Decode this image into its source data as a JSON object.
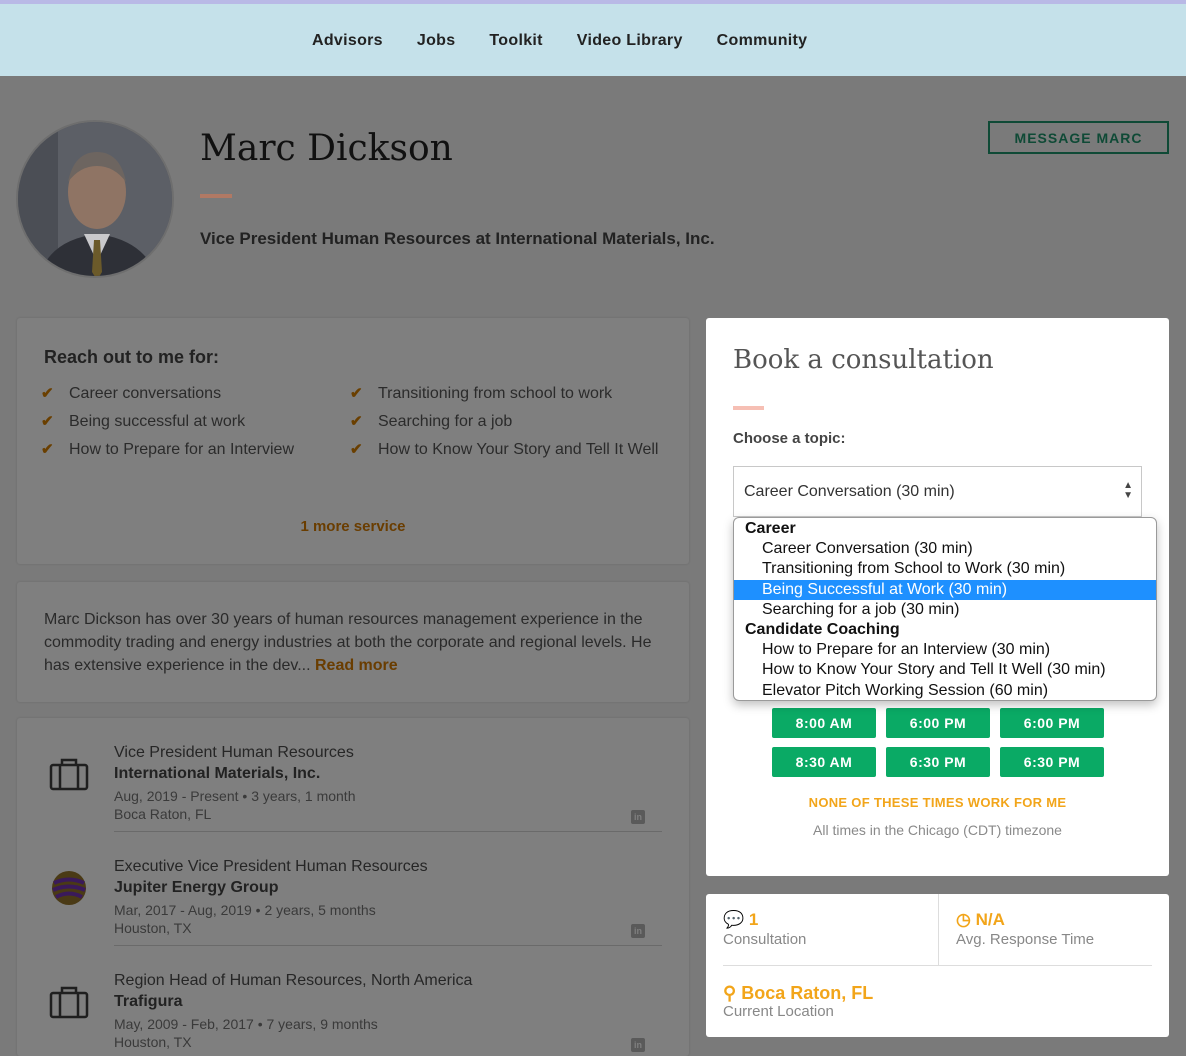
{
  "nav": {
    "items": [
      "Advisors",
      "Jobs",
      "Toolkit",
      "Video Library",
      "Community"
    ]
  },
  "profile": {
    "name": "Marc Dickson",
    "headline": "Vice President Human Resources at International Materials, Inc.",
    "message_button": "MESSAGE MARC"
  },
  "reach": {
    "heading": "Reach out to me for:",
    "services": [
      "Career conversations",
      "Transitioning from school to work",
      "Being successful at work",
      "Searching for a job",
      "How to Prepare for an Interview",
      "How to Know Your Story and Tell It Well"
    ],
    "more": "1 more service"
  },
  "bio": {
    "text": "Marc Dickson has over 30 years of human resources management experience in the commodity trading and energy industries at both the corporate and regional levels. He has extensive experience in the dev... ",
    "read_more": "Read more"
  },
  "experience": [
    {
      "title": "Vice President Human Resources",
      "company": "International Materials, Inc.",
      "dates": "Aug, 2019 - Present • 3 years, 1 month",
      "location": "Boca Raton, FL",
      "logo": "briefcase-icon"
    },
    {
      "title": "Executive Vice President Human Resources",
      "company": "Jupiter Energy Group",
      "dates": "Mar, 2017 - Aug, 2019 • 2 years, 5 months",
      "location": "Houston, TX",
      "logo": "jupiter-logo"
    },
    {
      "title": "Region Head of Human Resources, North America",
      "company": "Trafigura",
      "dates": "May, 2009 - Feb, 2017 • 7 years, 9 months",
      "location": "Houston, TX",
      "logo": "briefcase-icon"
    }
  ],
  "booking": {
    "title": "Book a consultation",
    "topic_label": "Choose a topic:",
    "selected_topic": "Career Conversation (30 min)",
    "dropdown": {
      "groups": [
        {
          "label": "Career",
          "options": [
            "Career Conversation (30 min)",
            "Transitioning from School to Work (30 min)",
            "Being Successful at Work (30 min)",
            "Searching for a job (30 min)"
          ]
        },
        {
          "label": "Candidate Coaching",
          "options": [
            "How to Prepare for an Interview (30 min)",
            "How to Know Your Story and Tell It Well (30 min)",
            "Elevator Pitch Working Session (60 min)"
          ]
        }
      ],
      "highlighted": "Being Successful at Work (30 min)"
    },
    "times": [
      "8:00 AM",
      "6:00 PM",
      "6:00 PM",
      "8:30 AM",
      "6:30 PM",
      "6:30 PM"
    ],
    "none_work": "NONE OF THESE TIMES WORK FOR ME",
    "timezone": "All times in the Chicago (CDT) timezone"
  },
  "stats": {
    "consultations": {
      "value": "1",
      "label": "Consultation"
    },
    "response": {
      "value": "N/A",
      "label": "Avg. Response Time"
    },
    "location": {
      "value": "Boca Raton, FL",
      "label": "Current Location"
    }
  },
  "colors": {
    "accent_orange": "#f2a51a",
    "time_green": "#0aaa65",
    "select_highlight": "#1e90ff"
  }
}
